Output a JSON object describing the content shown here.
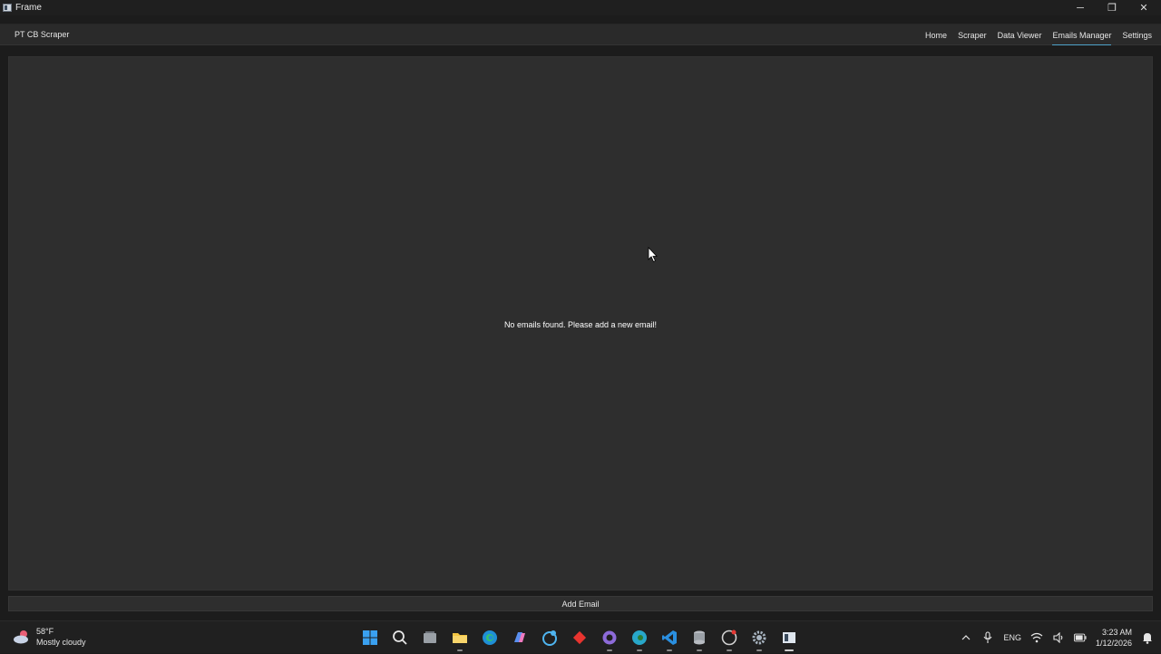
{
  "window": {
    "title": "Frame",
    "controls": {
      "minimize": "─",
      "restore": "❐",
      "close": "✕"
    }
  },
  "header": {
    "brand": "PT CB Scraper",
    "nav": [
      {
        "label": "Home",
        "active": false
      },
      {
        "label": "Scraper",
        "active": false
      },
      {
        "label": "Data Viewer",
        "active": false
      },
      {
        "label": "Emails Manager",
        "active": true
      },
      {
        "label": "Settings",
        "active": false
      }
    ]
  },
  "main": {
    "empty_message": "No emails found. Please add a new email!"
  },
  "footer": {
    "add_button": "Add Email"
  },
  "taskbar": {
    "weather": {
      "temp": "58°F",
      "condition": "Mostly cloudy"
    },
    "apps": [
      "windows-start",
      "search",
      "task-view",
      "file-explorer",
      "edge",
      "copilot",
      "store",
      "app-red",
      "app-purple",
      "edge-dev",
      "vscode",
      "database",
      "github-desktop",
      "settings",
      "frame-app"
    ],
    "tray": {
      "language": "ENG",
      "time": "3:23 AM",
      "date": "1/12/2026"
    }
  },
  "colors": {
    "accent": "#4fa3c9",
    "panel_bg": "#2e2e2e",
    "window_bg": "#1c1c1c"
  }
}
